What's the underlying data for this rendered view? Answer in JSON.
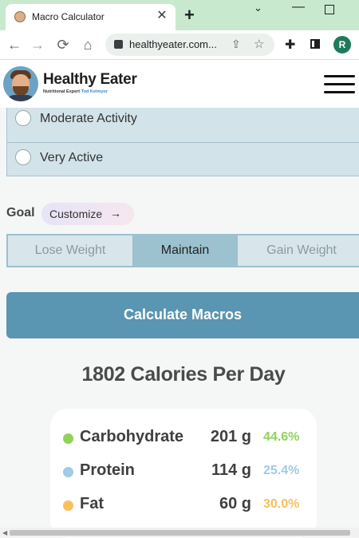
{
  "browser": {
    "tab_title": "Macro Calculator",
    "tab_close": "✕",
    "new_tab": "+",
    "url": "healthyeater.com...",
    "profile_initial": "R",
    "window_controls": {
      "dropdown": "⌄",
      "minimize": "—"
    }
  },
  "site": {
    "brand": "Healthy Eater",
    "tagline_prefix": "Nutritional Expert",
    "tagline_name": "Tod Kelmyor"
  },
  "activity": {
    "options": [
      {
        "label": "Moderate Activity",
        "selected": false
      },
      {
        "label": "Very Active",
        "selected": false
      }
    ]
  },
  "goal": {
    "label": "Goal",
    "customize_label": "Customize",
    "customize_arrow": "→",
    "options": [
      "Lose Weight",
      "Maintain",
      "Gain Weight"
    ],
    "selected": "Maintain"
  },
  "calculate_button": "Calculate Macros",
  "result": {
    "calories_text": "1802 Calories Per Day",
    "macros": [
      {
        "name": "Carbohydrate",
        "grams": "201 g",
        "percent": "44.6%",
        "color": "#8ed35a"
      },
      {
        "name": "Protein",
        "grams": "114 g",
        "percent": "25.4%",
        "color": "#9fcbe4"
      },
      {
        "name": "Fat",
        "grams": "60 g",
        "percent": "30.0%",
        "color": "#fbbf5b"
      }
    ]
  },
  "colors": {
    "accent_button": "#5a95b1",
    "segment_selected": "#9cc2cf",
    "radio_panel": "#d3e3ea"
  },
  "icons": [
    "back-icon",
    "forward-icon",
    "reload-icon",
    "home-icon",
    "lock-icon",
    "share-icon",
    "star-icon",
    "extensions-icon",
    "side-panel-icon",
    "hamburger-menu-icon"
  ]
}
